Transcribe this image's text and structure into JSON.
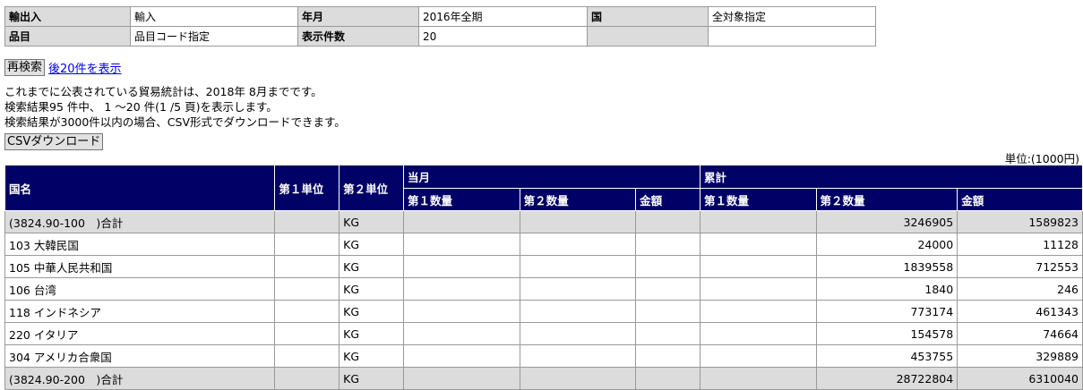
{
  "conditions": {
    "row1": [
      {
        "label": "輸出入",
        "value": "輸入"
      },
      {
        "label": "年月",
        "value": "2016年全期"
      },
      {
        "label": "国",
        "value": "全対象指定"
      }
    ],
    "row2": [
      {
        "label": "品目",
        "value": "品目コード指定"
      },
      {
        "label": "表示件数",
        "value": "20"
      },
      {
        "label": "",
        "value": ""
      }
    ]
  },
  "actions": {
    "research_button": "再検索",
    "next_link": "後20件を表示",
    "csv_button": "CSVダウンロード"
  },
  "info": {
    "line1": "これまでに公表されている貿易統計は、2018年 8月までです。",
    "line2": "検索結果95 件中、 1 ～20 件(1 /5 頁)を表示します。",
    "line3": "検索結果が3000件以内の場合、CSV形式でダウンロードできます。"
  },
  "unit_label": "単位:(1000円)",
  "table": {
    "headers": {
      "country": "国名",
      "unit1": "第１単位",
      "unit2": "第２単位",
      "current": "当月",
      "cumulative": "累計",
      "qty1": "第１数量",
      "qty2": "第２数量",
      "amount": "金額"
    },
    "rows": [
      {
        "name": "(3824.90-100　)合計",
        "u1": "",
        "u2": "KG",
        "m_q1": "",
        "m_q2": "",
        "m_amt": "",
        "c_q1": "",
        "c_q2": "3246905",
        "c_amt": "1589823",
        "sum": true
      },
      {
        "name": "103 大韓民国",
        "u1": "",
        "u2": "KG",
        "m_q1": "",
        "m_q2": "",
        "m_amt": "",
        "c_q1": "",
        "c_q2": "24000",
        "c_amt": "11128",
        "sum": false
      },
      {
        "name": "105 中華人民共和国",
        "u1": "",
        "u2": "KG",
        "m_q1": "",
        "m_q2": "",
        "m_amt": "",
        "c_q1": "",
        "c_q2": "1839558",
        "c_amt": "712553",
        "sum": false
      },
      {
        "name": "106 台湾",
        "u1": "",
        "u2": "KG",
        "m_q1": "",
        "m_q2": "",
        "m_amt": "",
        "c_q1": "",
        "c_q2": "1840",
        "c_amt": "246",
        "sum": false
      },
      {
        "name": "118 インドネシア",
        "u1": "",
        "u2": "KG",
        "m_q1": "",
        "m_q2": "",
        "m_amt": "",
        "c_q1": "",
        "c_q2": "773174",
        "c_amt": "461343",
        "sum": false
      },
      {
        "name": "220 イタリア",
        "u1": "",
        "u2": "KG",
        "m_q1": "",
        "m_q2": "",
        "m_amt": "",
        "c_q1": "",
        "c_q2": "154578",
        "c_amt": "74664",
        "sum": false
      },
      {
        "name": "304 アメリカ合衆国",
        "u1": "",
        "u2": "KG",
        "m_q1": "",
        "m_q2": "",
        "m_amt": "",
        "c_q1": "",
        "c_q2": "453755",
        "c_amt": "329889",
        "sum": false
      },
      {
        "name": "(3824.90-200　)合計",
        "u1": "",
        "u2": "KG",
        "m_q1": "",
        "m_q2": "",
        "m_amt": "",
        "c_q1": "",
        "c_q2": "28722804",
        "c_amt": "6310040",
        "sum": true
      }
    ]
  }
}
